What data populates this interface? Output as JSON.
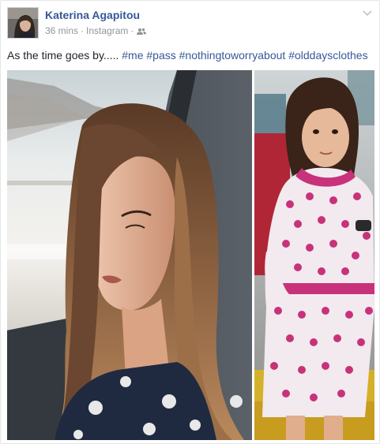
{
  "post": {
    "author": "Katerina Agapitou",
    "time": "36 mins",
    "source": "Instagram",
    "separator": "·",
    "audience_icon": "friends-icon",
    "menu_icon": "chevron-down-icon",
    "caption_text": "As the time goes by.....",
    "hashtags": [
      "#me",
      "#pass",
      "#nothingtoworryabout",
      "#olddaysclothes"
    ]
  },
  "photos": {
    "left_description_icon": "photo-woman-in-car",
    "right_description_icon": "photo-girl-polka-dot-dress"
  },
  "colors": {
    "link": "#365899",
    "meta": "#90949c",
    "text": "#1d2129"
  }
}
